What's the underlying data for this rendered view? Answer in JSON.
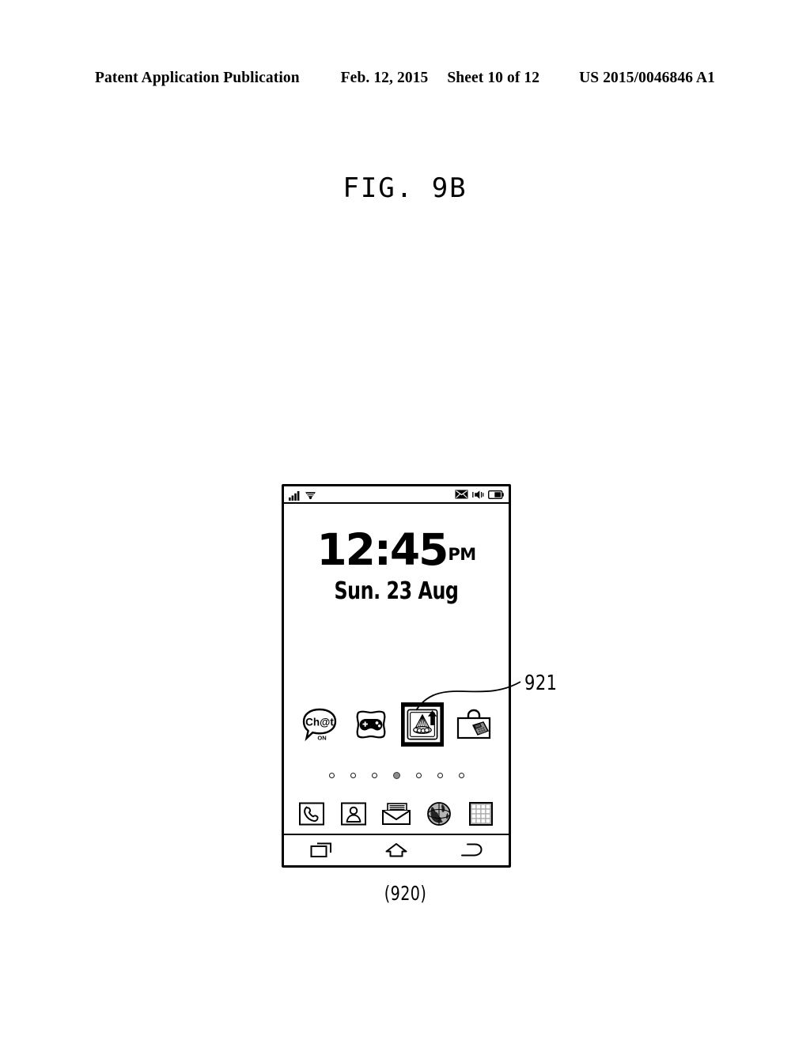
{
  "header": {
    "publication": "Patent Application Publication",
    "date": "Feb. 12, 2015",
    "sheet": "Sheet 10 of 12",
    "docnum": "US 2015/0046846 A1"
  },
  "figure": {
    "title": "FIG. 9B",
    "caption": "(920)",
    "callout_label": "921"
  },
  "device": {
    "statusbar": {
      "left_icons": [
        {
          "name": "signal-bars-icon",
          "label": "signal"
        },
        {
          "name": "wifi-icon",
          "label": "wifi"
        }
      ],
      "right_icons": [
        {
          "name": "message-envelope-icon",
          "label": "new message"
        },
        {
          "name": "volume-speaker-icon",
          "label": "sound"
        },
        {
          "name": "battery-icon",
          "label": "battery"
        }
      ]
    },
    "clock": {
      "time": "12:45",
      "ampm": "PM",
      "date": "Sun. 23 Aug"
    },
    "apps": [
      {
        "name": "app-icon-chaton",
        "label": "Ch@t",
        "sublabel": "ON",
        "selected": false
      },
      {
        "name": "app-icon-games",
        "label": "Games",
        "selected": false
      },
      {
        "name": "app-icon-gallery",
        "label": "Gallery",
        "selected": true
      },
      {
        "name": "app-icon-toolbox",
        "label": "Toolbox",
        "selected": false
      }
    ],
    "page_indicator": {
      "count": 7,
      "active_index": 3
    },
    "dock": [
      {
        "name": "dock-icon-phone",
        "label": "Phone"
      },
      {
        "name": "dock-icon-contacts",
        "label": "Contacts"
      },
      {
        "name": "dock-icon-messages",
        "label": "Messages"
      },
      {
        "name": "dock-icon-browser",
        "label": "Internet"
      },
      {
        "name": "dock-icon-apps",
        "label": "Apps"
      }
    ],
    "navbar": [
      {
        "name": "nav-recents-button",
        "label": "Recents"
      },
      {
        "name": "nav-home-button",
        "label": "Home"
      },
      {
        "name": "nav-back-button",
        "label": "Back"
      }
    ]
  },
  "colors": {
    "ink": "#000000",
    "paper": "#ffffff",
    "dot_active": "#8c8c8c",
    "icon_gray": "#8a8a8a"
  }
}
